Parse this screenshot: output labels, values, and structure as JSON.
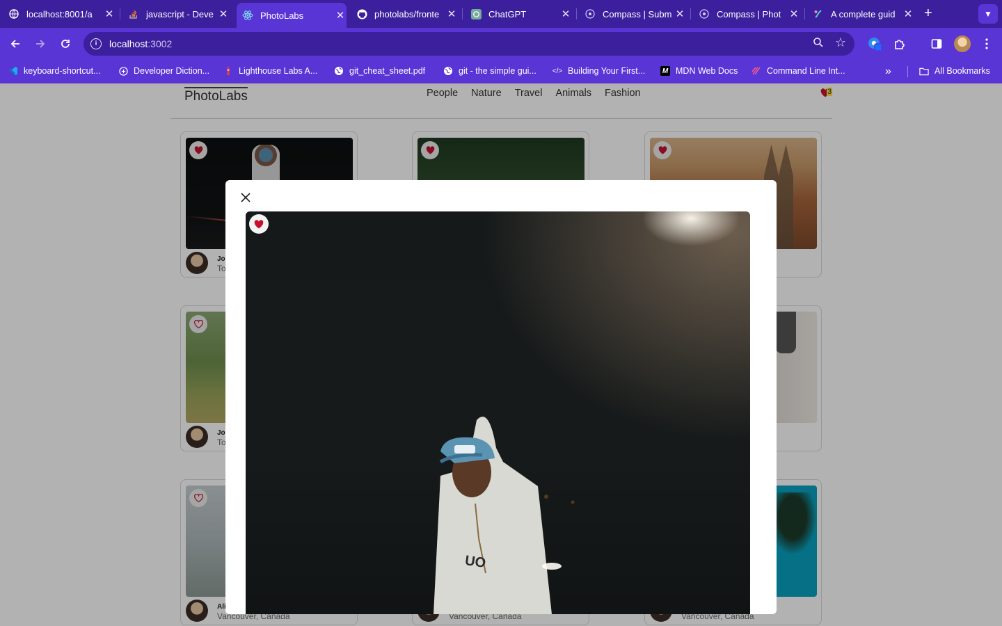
{
  "browser": {
    "tabs": [
      {
        "title": "localhost:8001/a",
        "icon": "globe-icon",
        "active": false
      },
      {
        "title": "javascript - Deve",
        "icon": "stackoverflow-icon",
        "active": false
      },
      {
        "title": "PhotoLabs",
        "icon": "react-icon",
        "active": true
      },
      {
        "title": "photolabs/fronte",
        "icon": "github-icon",
        "active": false
      },
      {
        "title": "ChatGPT",
        "icon": "chatgpt-icon",
        "active": false
      },
      {
        "title": "Compass | Subm",
        "icon": "compass-icon",
        "active": false
      },
      {
        "title": "Compass | Phot",
        "icon": "compass-icon",
        "active": false
      },
      {
        "title": "A complete guid",
        "icon": "guide-icon",
        "active": false
      }
    ],
    "url_host": "localhost",
    "url_port": ":3002",
    "bookmarks": [
      {
        "label": "keyboard-shortcut...",
        "icon": "vscode-icon"
      },
      {
        "label": "Developer Diction...",
        "icon": "plus-circle-icon"
      },
      {
        "label": "Lighthouse Labs A...",
        "icon": "lighthouse-icon"
      },
      {
        "label": "git_cheat_sheet.pdf",
        "icon": "globe-icon"
      },
      {
        "label": "git - the simple gui...",
        "icon": "globe-icon"
      },
      {
        "label": "Building Your First...",
        "icon": "code-icon"
      },
      {
        "label": "MDN Web Docs",
        "icon": "mdn-icon"
      },
      {
        "label": "Command Line Int...",
        "icon": "cli-icon"
      }
    ],
    "all_bookmarks": "All Bookmarks"
  },
  "app": {
    "logo": "PhotoLabs",
    "topics": [
      "People",
      "Nature",
      "Travel",
      "Animals",
      "Fashion"
    ],
    "fav_count": "3",
    "accent_color": "#c8102e"
  },
  "cards": [
    {
      "name": "Jo",
      "location": "To",
      "favorited": true
    },
    {
      "name": "",
      "location": "",
      "favorited": true
    },
    {
      "name": "",
      "location": "",
      "favorited": true
    },
    {
      "name": "Jo",
      "location": "To",
      "favorited": false
    },
    {
      "name": "",
      "location": "",
      "favorited": false
    },
    {
      "name": "",
      "location": "",
      "favorited": false
    },
    {
      "name": "Ali",
      "location": "Vancouver, Canada",
      "favorited": false
    },
    {
      "name": "",
      "location": "Vancouver, Canada",
      "favorited": false
    },
    {
      "name": "",
      "location": "Vancouver, Canada",
      "favorited": false
    }
  ],
  "modal": {
    "close_icon": "close-icon",
    "favorited": true
  }
}
